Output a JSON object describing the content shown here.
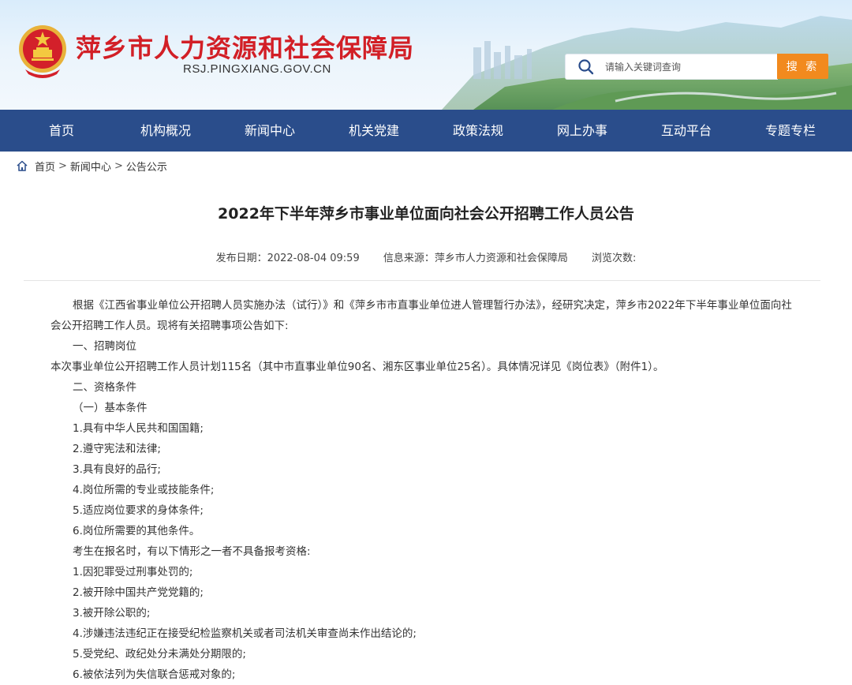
{
  "header": {
    "site_title": "萍乡市人力资源和社会保障局",
    "site_domain": "RSJ.PINGXIANG.GOV.CN",
    "emblem": "national-emblem",
    "search_placeholder": "请输入关键词查询",
    "search_button": "搜 索",
    "colors": {
      "title": "#d21f26",
      "nav": "#2a4d8b",
      "search_button": "#f28a1e"
    }
  },
  "nav": {
    "items": [
      "首页",
      "机构概况",
      "新闻中心",
      "机关党建",
      "政策法规",
      "网上办事",
      "互动平台",
      "专题专栏"
    ]
  },
  "breadcrumb": {
    "icon": "home-icon",
    "items": [
      "首页",
      "新闻中心",
      "公告公示"
    ],
    "separator": ">"
  },
  "article": {
    "title": "2022年下半年萍乡市事业单位面向社会公开招聘工作人员公告",
    "publish_date": "发布日期：2022-08-04 09:59",
    "source": "信息来源：萍乡市人力资源和社会保障局",
    "views": "浏览次数:",
    "paragraphs": [
      "根据《江西省事业单位公开招聘人员实施办法（试行）》和《萍乡市市直事业单位进人管理暂行办法》，经研究决定，萍乡市2022年下半年事业单位面向社会公开招聘工作人员。现将有关招聘事项公告如下:",
      "一、招聘岗位",
      "本次事业单位公开招聘工作人员计划115名（其中市直事业单位90名、湘东区事业单位25名）。具体情况详见《岗位表》（附件1）。",
      "二、资格条件",
      "（一）基本条件",
      "1.具有中华人民共和国国籍;",
      "2.遵守宪法和法律;",
      "3.具有良好的品行;",
      "4.岗位所需的专业或技能条件;",
      "5.适应岗位要求的身体条件;",
      "6.岗位所需要的其他条件。",
      "考生在报名时，有以下情形之一者不具备报考资格:",
      "1.因犯罪受过刑事处罚的;",
      "2.被开除中国共产党党籍的;",
      "3.被开除公职的;",
      "4.涉嫌违法违纪正在接受纪检监察机关或者司法机关审查尚未作出结论的;",
      "5.受党纪、政纪处分未满处分期限的;",
      "6.被依法列为失信联合惩戒对象的;"
    ]
  }
}
